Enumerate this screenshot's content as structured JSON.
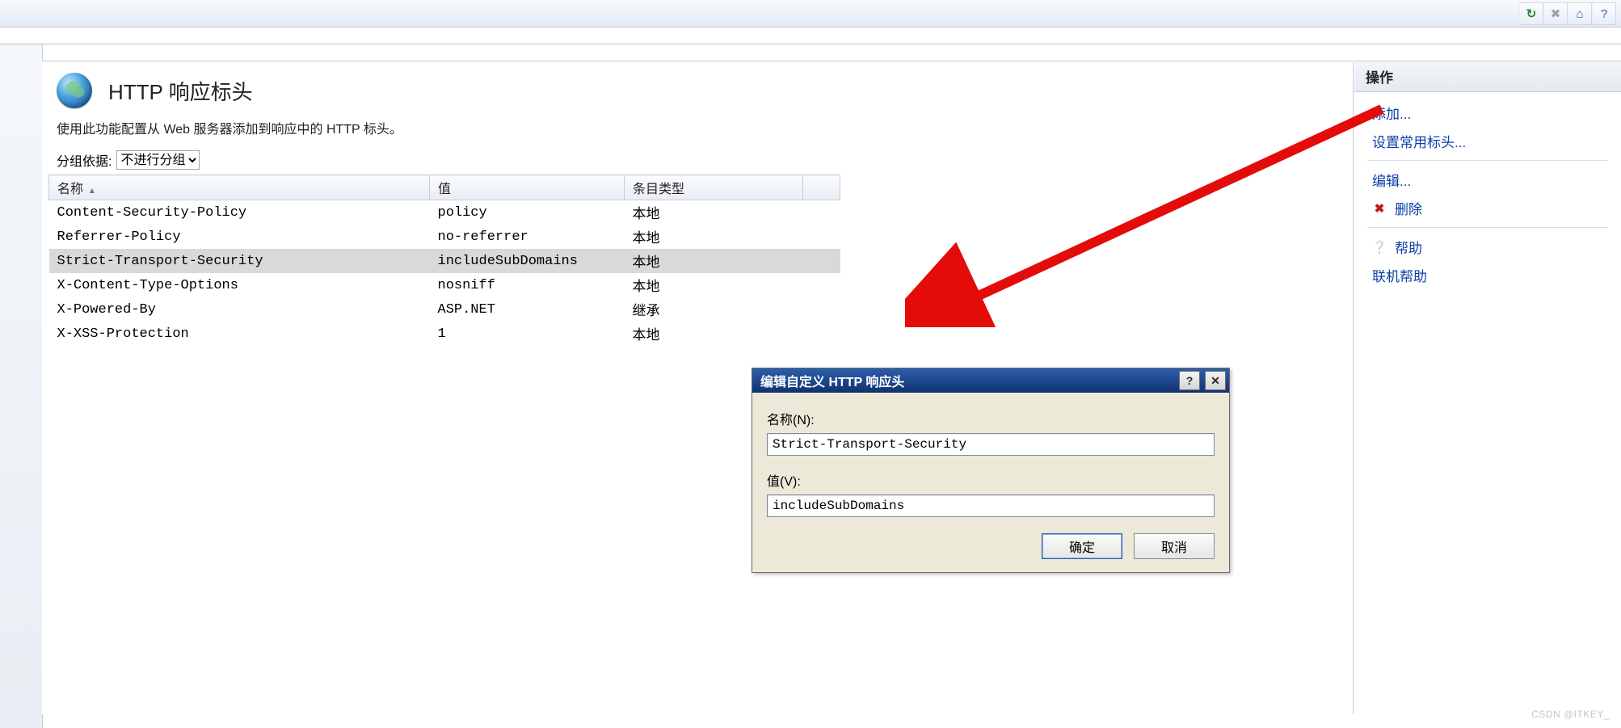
{
  "toolbar": {
    "refresh": "↻",
    "stop": "✖",
    "home": "⌂",
    "help": "?"
  },
  "page": {
    "title": "HTTP 响应标头",
    "description": "使用此功能配置从 Web 服务器添加到响应中的 HTTP 标头。"
  },
  "groupby": {
    "label": "分组依据:",
    "selected": "不进行分组"
  },
  "columns": {
    "name": "名称",
    "value": "值",
    "type": "条目类型"
  },
  "rows": [
    {
      "name": "Content-Security-Policy",
      "value": "policy",
      "type": "本地",
      "selected": false
    },
    {
      "name": "Referrer-Policy",
      "value": "no-referrer",
      "type": "本地",
      "selected": false
    },
    {
      "name": "Strict-Transport-Security",
      "value": "includeSubDomains",
      "type": "本地",
      "selected": true
    },
    {
      "name": "X-Content-Type-Options",
      "value": "nosniff",
      "type": "本地",
      "selected": false
    },
    {
      "name": "X-Powered-By",
      "value": "ASP.NET",
      "type": "继承",
      "selected": false
    },
    {
      "name": "X-XSS-Protection",
      "value": "1",
      "type": "本地",
      "selected": false
    }
  ],
  "actions": {
    "title": "操作",
    "add": "添加...",
    "set_common": "设置常用标头...",
    "edit": "编辑...",
    "delete": "删除",
    "help": "帮助",
    "online_help": "联机帮助"
  },
  "dialog": {
    "title": "编辑自定义 HTTP 响应头",
    "name_label": "名称(N):",
    "name_value": "Strict-Transport-Security",
    "value_label": "值(V):",
    "value_value": "includeSubDomains",
    "ok": "确定",
    "cancel": "取消",
    "help_btn": "?",
    "close_btn": "✕"
  },
  "watermark": "CSDN @ITKEY_"
}
